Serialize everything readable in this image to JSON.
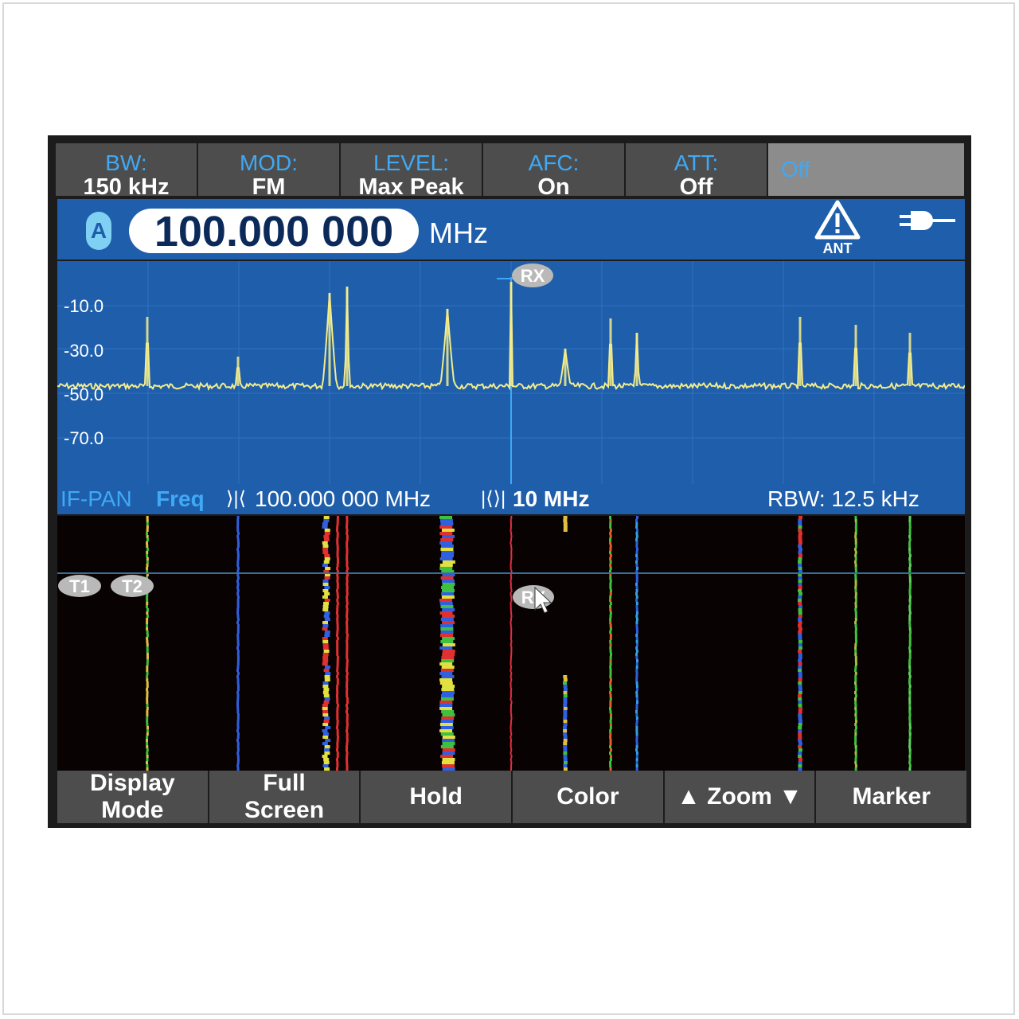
{
  "top_keys": [
    {
      "label": "BW:",
      "value": "150 kHz"
    },
    {
      "label": "MOD:",
      "value": "FM"
    },
    {
      "label": "LEVEL:",
      "value": "Max Peak"
    },
    {
      "label": "AFC:",
      "value": "On"
    },
    {
      "label": "ATT:",
      "value": "Off"
    },
    {
      "label": "Off",
      "value": ""
    }
  ],
  "header": {
    "channel": "A",
    "frequency": "100.000 000",
    "unit": "MHz",
    "antenna_label": "ANT",
    "antenna_icon": "warning-triangle-icon",
    "power_icon": "power-plug-icon"
  },
  "spectrum": {
    "y_ticks": [
      "-10.0",
      "-30.0",
      "-50.0",
      "-70.0"
    ],
    "rx_marker": "RX",
    "colors": {
      "background": "#1f5eaa",
      "trace": "#f3ec8a",
      "grid": "#2f73c1"
    }
  },
  "info": {
    "mode": "IF-PAN",
    "freq_label": "Freq",
    "center_icon": "center-freq-icon",
    "center_freq": "100.000 000 MHz",
    "span_icon": "span-icon",
    "span": "10 MHz",
    "rbw": "RBW: 12.5 kHz"
  },
  "waterfall": {
    "markers": [
      "T1",
      "T2"
    ],
    "rx_marker": "RX"
  },
  "bottom_keys": [
    {
      "label": "Display\nMode"
    },
    {
      "label": "Full\nScreen"
    },
    {
      "label": "Hold"
    },
    {
      "label": "Color"
    },
    {
      "label": "▲ Zoom ▼"
    },
    {
      "label": "Marker"
    }
  ]
}
